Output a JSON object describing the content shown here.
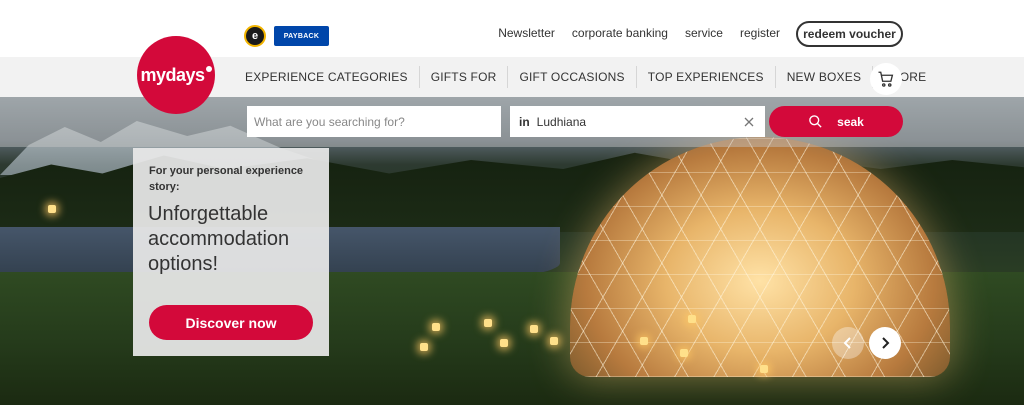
{
  "header": {
    "badges": {
      "trusted_mark": "e",
      "payback_label": "PAYBACK"
    },
    "links": [
      "Newsletter",
      "corporate banking",
      "service",
      "register"
    ],
    "voucher_button": "redeem voucher"
  },
  "logo": {
    "text": "mydays"
  },
  "nav": {
    "items": [
      "EXPERIENCE CATEGORIES",
      "GIFTS FOR",
      "GIFT OCCASIONS",
      "TOP EXPERIENCES",
      "NEW BOXES",
      "STORE"
    ],
    "cart_icon": "cart-icon"
  },
  "search": {
    "placeholder": "What are you searching for?",
    "location_prefix": "in",
    "location_value": "Ludhiana",
    "button_label": "seak"
  },
  "promo": {
    "eyebrow": "For your personal experience story:",
    "title": "Unforgettable accommodation options!",
    "button_label": "Discover now"
  },
  "colors": {
    "brand": "#d3093a",
    "text": "#333333",
    "nav_bg": "#f2f2f2"
  }
}
